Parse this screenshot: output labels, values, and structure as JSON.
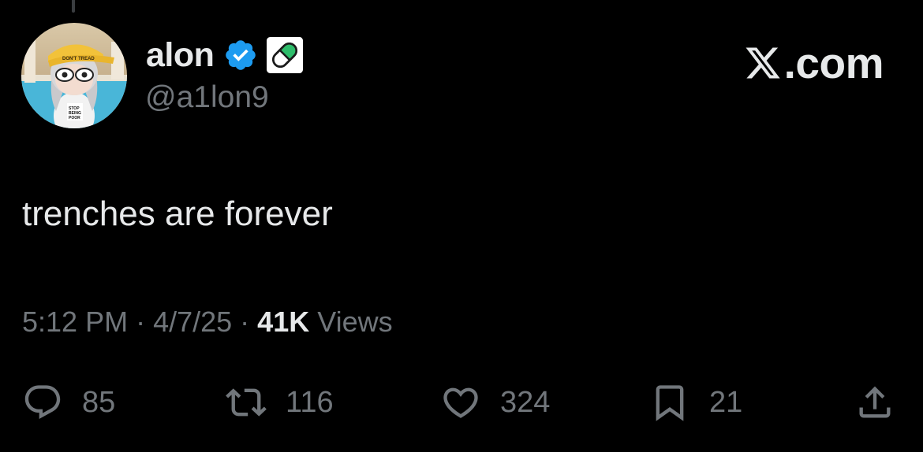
{
  "post": {
    "author": {
      "display_name": "alon",
      "handle": "@a1lon9",
      "verified_badge_icon": "verified-check-icon",
      "affiliate_badge_icon": "pill-icon",
      "avatar_cap_text": "DON'T TREAD",
      "avatar_shirt_text": "STOP BEING POOR"
    },
    "brand": {
      "text": ".com",
      "logo_icon": "x-logo-icon"
    },
    "text": "trenches are forever",
    "time": "5:12 PM",
    "separator": "·",
    "date": "4/7/25",
    "views_count": "41K",
    "views_label": "Views"
  },
  "actions": {
    "reply": {
      "icon": "reply-icon",
      "count": "85"
    },
    "repost": {
      "icon": "repost-icon",
      "count": "116"
    },
    "like": {
      "icon": "heart-icon",
      "count": "324"
    },
    "bookmark": {
      "icon": "bookmark-icon",
      "count": "21"
    },
    "share": {
      "icon": "share-icon"
    }
  },
  "colors": {
    "background": "#000000",
    "primary_text": "#e7e9ea",
    "secondary_text": "#71767b",
    "verified_blue": "#1d9bf0",
    "pill_green": "#2ebd6b"
  }
}
